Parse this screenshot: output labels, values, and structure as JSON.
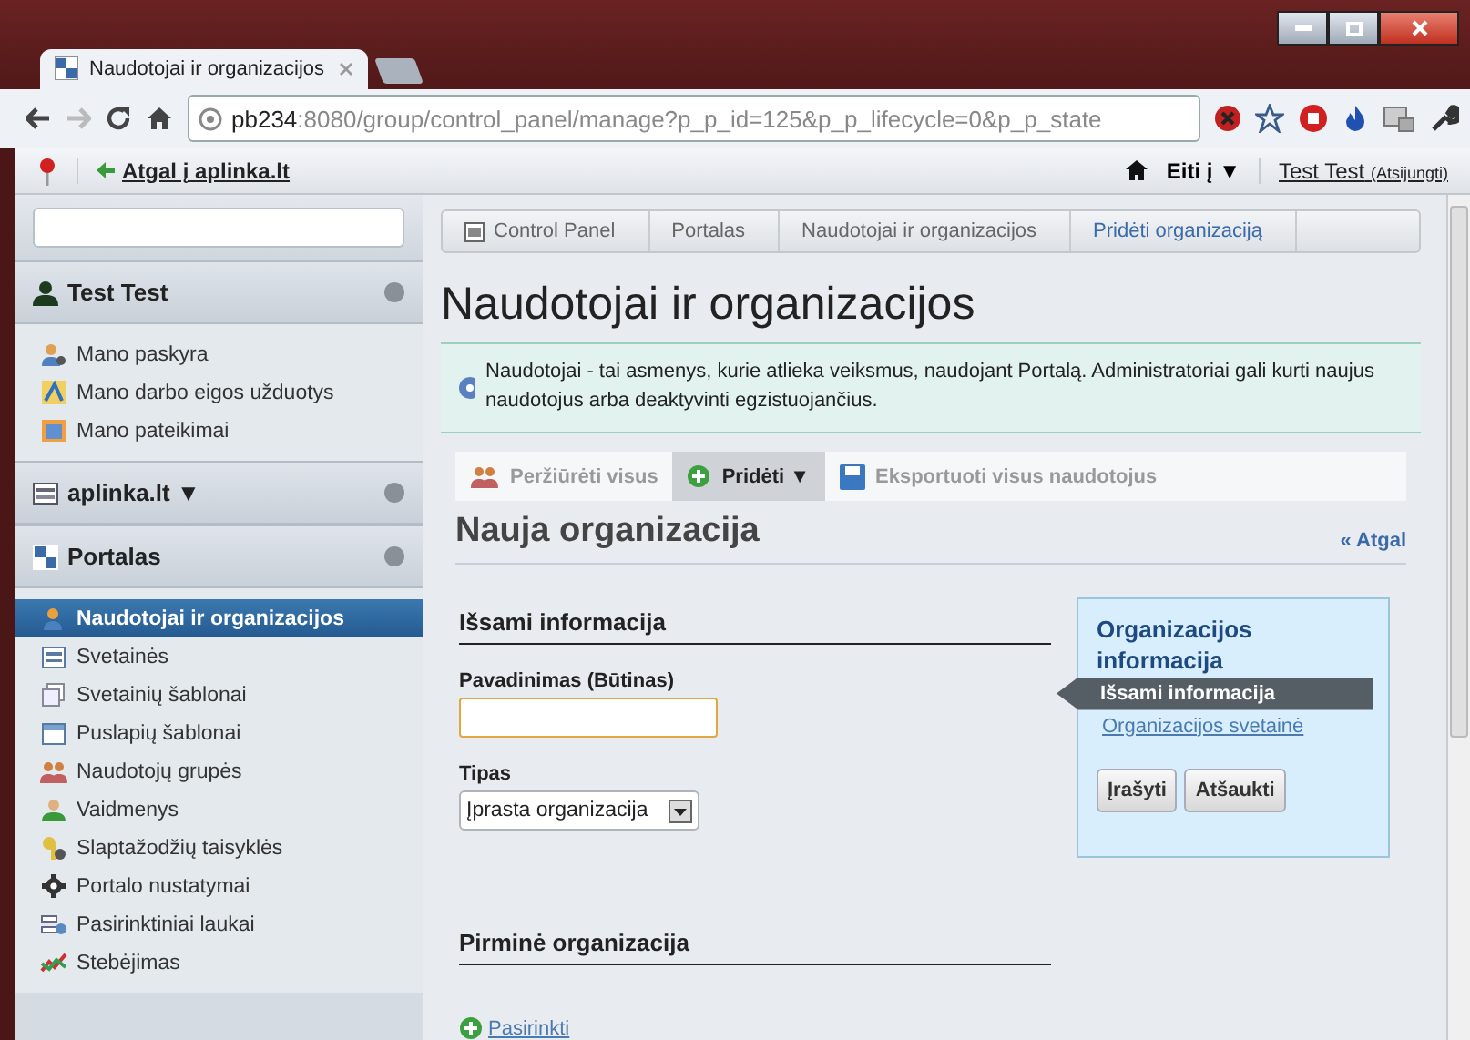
{
  "browser": {
    "tabs": [
      {
        "label": "Naudotojai ir organizacijos",
        "selected": true
      }
    ],
    "address": {
      "host": "pb234",
      "path": ":8080/group/control_panel/manage?p_p_id=125&p_p_lifecycle=0&p_p_state"
    }
  },
  "dock": {
    "back_link": "Atgal į aplinka.lt",
    "goto": "Eiti į",
    "caret": "▼",
    "user": "Test Test",
    "logout": "(Atsijungti)"
  },
  "sidebar": {
    "sections": [
      {
        "title": "Test Test",
        "kind": "user",
        "items": [
          {
            "label": "Mano paskyra",
            "selected": false
          },
          {
            "label": "Mano darbo eigos užduotys",
            "selected": false
          },
          {
            "label": "Mano pateikimai",
            "selected": false
          }
        ]
      },
      {
        "title": "aplinka.lt",
        "kind": "site",
        "caret": "▼"
      },
      {
        "title": "Portalas",
        "kind": "portal",
        "items": [
          {
            "label": "Naudotojai ir organizacijos",
            "selected": true
          },
          {
            "label": "Svetainės",
            "selected": false
          },
          {
            "label": "Svetainių šablonai",
            "selected": false
          },
          {
            "label": "Puslapių šablonai",
            "selected": false
          },
          {
            "label": "Naudotojų grupės",
            "selected": false
          },
          {
            "label": "Vaidmenys",
            "selected": false
          },
          {
            "label": "Slaptažodžių taisyklės",
            "selected": false
          },
          {
            "label": "Portalo nustatymai",
            "selected": false
          },
          {
            "label": "Pasirinktiniai laukai",
            "selected": false
          },
          {
            "label": "Stebėjimas",
            "selected": false
          }
        ]
      }
    ]
  },
  "breadcrumb": [
    {
      "label": "Control Panel",
      "selected": false
    },
    {
      "label": "Portalas",
      "selected": false
    },
    {
      "label": "Naudotojai ir organizacijos",
      "selected": false
    },
    {
      "label": "Pridėti organizaciją",
      "selected": true
    }
  ],
  "title": "Naudotojai ir organizacijos",
  "info": "Naudotojai - tai asmenys, kurie atlieka veiksmus, naudojant Portalą. Administratoriai gali kurti naujus naudotojus arba deaktyvinti egzistuojančius.",
  "toolbar": [
    {
      "label": "Peržiūrėti visus",
      "selected": false
    },
    {
      "label": "Pridėti",
      "selected": true,
      "caret": "▼"
    },
    {
      "label": "Eksportuoti visus naudotojus",
      "selected": false
    }
  ],
  "heading": "Nauja organizacija",
  "back_link": "« Atgal",
  "form": {
    "section1": "Išsami informacija",
    "name_label": "Pavadinimas (Būtinas)",
    "type_label": "Tipas",
    "type_value": "Įprasta organizacija",
    "section2": "Pirminė organizacija",
    "select_link": "Pasirinkti"
  },
  "panel": {
    "title": "Organizacijos informacija",
    "nav": [
      {
        "label": "Išsami informacija",
        "selected": true
      },
      {
        "label": "Organizacijos svetainė",
        "selected": false
      }
    ],
    "buttons": [
      "Įrašyti",
      "Atšaukti"
    ]
  }
}
